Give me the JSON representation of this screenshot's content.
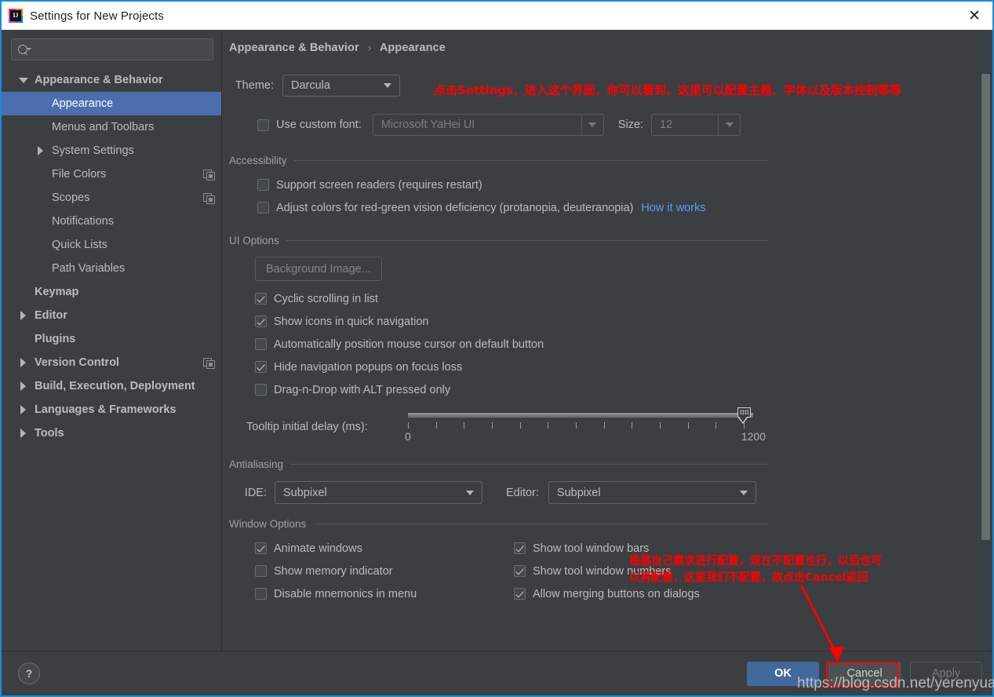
{
  "window": {
    "title": "Settings for New Projects",
    "close_label": "✕",
    "app_icon": "intellij-idea-icon",
    "accent_border": "#1a8cd8"
  },
  "sidebar": {
    "search": {
      "placeholder": "",
      "value": "",
      "icon": "search-icon"
    },
    "items": [
      {
        "label": "Appearance & Behavior",
        "level": 0,
        "twisty": "down",
        "bold": true,
        "selected": false,
        "copy": false
      },
      {
        "label": "Appearance",
        "level": 1,
        "twisty": "none",
        "bold": false,
        "selected": true,
        "copy": false
      },
      {
        "label": "Menus and Toolbars",
        "level": 1,
        "twisty": "none",
        "bold": false,
        "selected": false,
        "copy": false
      },
      {
        "label": "System Settings",
        "level": 1,
        "twisty": "right",
        "bold": false,
        "selected": false,
        "copy": false
      },
      {
        "label": "File Colors",
        "level": 1,
        "twisty": "none",
        "bold": false,
        "selected": false,
        "copy": true
      },
      {
        "label": "Scopes",
        "level": 1,
        "twisty": "none",
        "bold": false,
        "selected": false,
        "copy": true
      },
      {
        "label": "Notifications",
        "level": 1,
        "twisty": "none",
        "bold": false,
        "selected": false,
        "copy": false
      },
      {
        "label": "Quick Lists",
        "level": 1,
        "twisty": "none",
        "bold": false,
        "selected": false,
        "copy": false
      },
      {
        "label": "Path Variables",
        "level": 1,
        "twisty": "none",
        "bold": false,
        "selected": false,
        "copy": false
      },
      {
        "label": "Keymap",
        "level": 0,
        "twisty": "none",
        "bold": true,
        "selected": false,
        "copy": false
      },
      {
        "label": "Editor",
        "level": 0,
        "twisty": "right",
        "bold": true,
        "selected": false,
        "copy": false
      },
      {
        "label": "Plugins",
        "level": 0,
        "twisty": "none",
        "bold": true,
        "selected": false,
        "copy": false
      },
      {
        "label": "Version Control",
        "level": 0,
        "twisty": "right",
        "bold": true,
        "selected": false,
        "copy": true
      },
      {
        "label": "Build, Execution, Deployment",
        "level": 0,
        "twisty": "right",
        "bold": true,
        "selected": false,
        "copy": false
      },
      {
        "label": "Languages & Frameworks",
        "level": 0,
        "twisty": "right",
        "bold": true,
        "selected": false,
        "copy": false
      },
      {
        "label": "Tools",
        "level": 0,
        "twisty": "right",
        "bold": true,
        "selected": false,
        "copy": false
      }
    ]
  },
  "content": {
    "breadcrumb": {
      "root": "Appearance & Behavior",
      "separator": "›",
      "leaf": "Appearance"
    },
    "theme": {
      "label": "Theme:",
      "value": "Darcula"
    },
    "custom_font": {
      "checkbox_label": "Use custom font:",
      "checked": false,
      "font_value": "Microsoft YaHei UI",
      "size_label": "Size:",
      "size_value": "12"
    },
    "accessibility": {
      "title": "Accessibility",
      "options": [
        {
          "label": "Support screen readers (requires restart)",
          "checked": false
        },
        {
          "label": "Adjust colors for red-green vision deficiency (protanopia, deuteranopia)",
          "checked": false
        }
      ],
      "link": "How it works"
    },
    "ui_options": {
      "title": "UI Options",
      "background_image_button": "Background Image...",
      "options": [
        {
          "label": "Cyclic scrolling in list",
          "checked": true
        },
        {
          "label": "Show icons in quick navigation",
          "checked": true
        },
        {
          "label": "Automatically position mouse cursor on default button",
          "checked": false
        },
        {
          "label": "Hide navigation popups on focus loss",
          "checked": true
        },
        {
          "label": "Drag-n-Drop with ALT pressed only",
          "checked": false
        }
      ],
      "tooltip_delay": {
        "label": "Tooltip initial delay (ms):",
        "min_label": "0",
        "max_label": "1200",
        "min": 0,
        "max": 1200,
        "value": 1200
      }
    },
    "antialiasing": {
      "title": "Antialiasing",
      "ide_label": "IDE:",
      "ide_value": "Subpixel",
      "editor_label": "Editor:",
      "editor_value": "Subpixel"
    },
    "window_options": {
      "title": "Window Options",
      "left": [
        {
          "label": "Animate windows",
          "checked": true
        },
        {
          "label": "Show memory indicator",
          "checked": false
        },
        {
          "label": "Disable mnemonics in menu",
          "checked": false
        }
      ],
      "right": [
        {
          "label": "Show tool window bars",
          "checked": true
        },
        {
          "label": "Show tool window numbers",
          "checked": true
        },
        {
          "label": "Allow merging buttons on dialogs",
          "checked": true
        }
      ]
    }
  },
  "annotations": {
    "color": "#ff0000",
    "top_note": "点击Settings，进入这个界面，你可以看到，这里可以配置主题、字体以及版本控制等等",
    "bottom_note_line1": "根据自己需求进行配置，现在不配置也行，以后也可",
    "bottom_note_line2": "以再配置，这里我们不配置，故点击Cancel返回"
  },
  "watermark": {
    "text": "https://blog.csdn.net/yerenyuan_pku"
  },
  "footer": {
    "help_label": "?",
    "ok_label": "OK",
    "cancel_label": "Cancel",
    "apply_label": "Apply"
  }
}
